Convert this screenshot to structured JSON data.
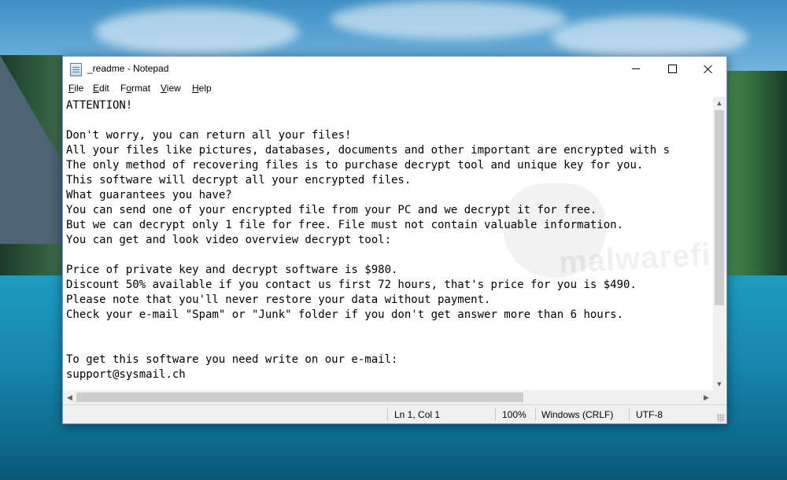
{
  "window": {
    "title": "_readme - Notepad",
    "minimize_icon": "minimize-icon",
    "maximize_icon": "maximize-icon",
    "close_icon": "close-icon"
  },
  "menu": {
    "items": [
      {
        "accel": "F",
        "rest": "ile"
      },
      {
        "accel": "E",
        "rest": "dit"
      },
      {
        "accel": "F",
        "rest": "ormat",
        "underline_index": 1
      },
      {
        "accel": "V",
        "rest": "iew"
      },
      {
        "accel": "H",
        "rest": "elp"
      }
    ],
    "labels": [
      "File",
      "Edit",
      "Format",
      "View",
      "Help"
    ]
  },
  "document": {
    "lines": [
      "ATTENTION!",
      "",
      "Don't worry, you can return all your files!",
      "All your files like pictures, databases, documents and other important are encrypted with s",
      "The only method of recovering files is to purchase decrypt tool and unique key for you.",
      "This software will decrypt all your encrypted files.",
      "What guarantees you have?",
      "You can send one of your encrypted file from your PC and we decrypt it for free.",
      "But we can decrypt only 1 file for free. File must not contain valuable information.",
      "You can get and look video overview decrypt tool:",
      "",
      "Price of private key and decrypt software is $980.",
      "Discount 50% available if you contact us first 72 hours, that's price for you is $490.",
      "Please note that you'll never restore your data without payment.",
      "Check your e-mail \"Spam\" or \"Junk\" folder if you don't get answer more than 6 hours.",
      "",
      "",
      "To get this software you need write on our e-mail:",
      "support@sysmail.ch"
    ]
  },
  "statusbar": {
    "position": "Ln 1, Col 1",
    "zoom": "100%",
    "line_ending": "Windows (CRLF)",
    "encoding": "UTF-8"
  },
  "watermark": {
    "text": "malwarefixes"
  },
  "colors": {
    "window_border": "#7a9cc8",
    "statusbar_bg": "#f0f0f0",
    "scrollbar_thumb": "#cdcdcd"
  }
}
